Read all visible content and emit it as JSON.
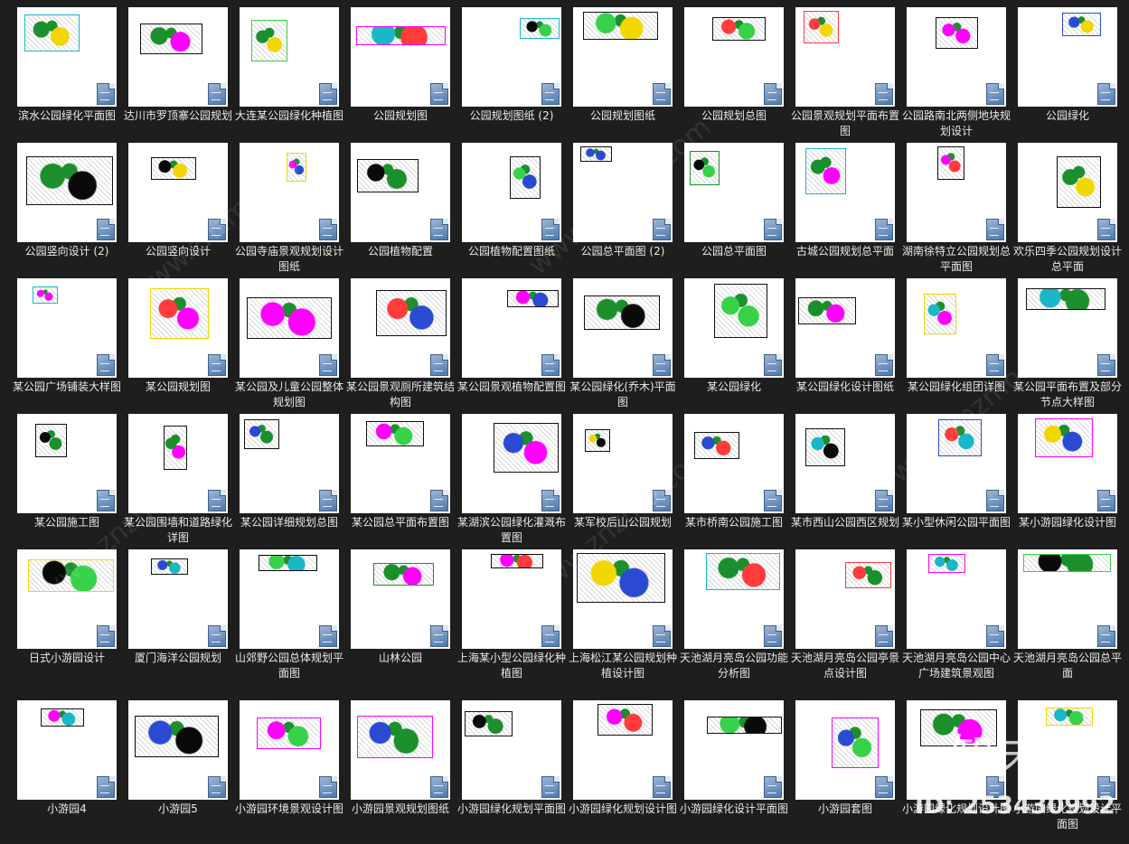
{
  "files": [
    {
      "name": "滨水公园绿化平面图",
      "icon": "cad-file-icon"
    },
    {
      "name": "达川市罗顶寨公园规划",
      "icon": "cad-file-icon"
    },
    {
      "name": "大连某公园绿化种植图",
      "icon": "cad-file-icon"
    },
    {
      "name": "公园规划图",
      "icon": "cad-file-icon"
    },
    {
      "name": "公园规划图纸 (2)",
      "icon": "cad-file-icon"
    },
    {
      "name": "公园规划图纸",
      "icon": "cad-file-icon"
    },
    {
      "name": "公园规划总图",
      "icon": "cad-file-icon"
    },
    {
      "name": "公园景观规划平面布置图",
      "icon": "cad-file-icon"
    },
    {
      "name": "公园路南北两侧地块规划设计",
      "icon": "cad-file-icon"
    },
    {
      "name": "公园绿化",
      "icon": "cad-file-icon"
    },
    {
      "name": "公园竖向设计 (2)",
      "icon": "cad-file-icon"
    },
    {
      "name": "公园竖向设计",
      "icon": "cad-file-icon"
    },
    {
      "name": "公园寺庙景观规划设计图纸",
      "icon": "cad-file-icon"
    },
    {
      "name": "公园植物配置",
      "icon": "cad-file-icon"
    },
    {
      "name": "公园植物配置图纸",
      "icon": "cad-file-icon"
    },
    {
      "name": "公园总平面图 (2)",
      "icon": "cad-file-icon"
    },
    {
      "name": "公园总平面图",
      "icon": "cad-file-icon"
    },
    {
      "name": "古城公园规划总平面",
      "icon": "cad-file-icon"
    },
    {
      "name": "湖南徐特立公园规划总平面图",
      "icon": "cad-file-icon"
    },
    {
      "name": "欢乐四季公园规划设计总平面",
      "icon": "cad-file-icon"
    },
    {
      "name": "某公园广场铺装大样图",
      "icon": "cad-file-icon"
    },
    {
      "name": "某公园规划图",
      "icon": "cad-file-icon"
    },
    {
      "name": "某公园及儿童公园整体规划图",
      "icon": "cad-file-icon"
    },
    {
      "name": "某公园景观厕所建筑结构图",
      "icon": "cad-file-icon"
    },
    {
      "name": "某公园景观植物配置图",
      "icon": "cad-file-icon"
    },
    {
      "name": "某公园绿化(乔木)平面图",
      "icon": "cad-file-icon"
    },
    {
      "name": "某公园绿化",
      "icon": "cad-file-icon"
    },
    {
      "name": "某公园绿化设计图纸",
      "icon": "cad-file-icon"
    },
    {
      "name": "某公园绿化组团详图",
      "icon": "cad-file-icon"
    },
    {
      "name": "某公园平面布置及部分节点大样图",
      "icon": "cad-file-icon"
    },
    {
      "name": "某公园施工图",
      "icon": "cad-file-icon"
    },
    {
      "name": "某公园围墙和道路绿化详图",
      "icon": "cad-file-icon"
    },
    {
      "name": "某公园详细规划总图",
      "icon": "cad-file-icon"
    },
    {
      "name": "某公园总平面布置图",
      "icon": "cad-file-icon"
    },
    {
      "name": "某湖滨公园绿化灌溉布置图",
      "icon": "cad-file-icon"
    },
    {
      "name": "某军校后山公园规划",
      "icon": "cad-file-icon"
    },
    {
      "name": "某市桥南公园施工图",
      "icon": "cad-file-icon"
    },
    {
      "name": "某市西山公园西区规划",
      "icon": "cad-file-icon"
    },
    {
      "name": "某小型休闲公园平面图",
      "icon": "cad-file-icon"
    },
    {
      "name": "某小游园绿化设计图",
      "icon": "cad-file-icon"
    },
    {
      "name": "日式小游园设计",
      "icon": "cad-file-icon"
    },
    {
      "name": "厦门海洋公园规划",
      "icon": "cad-file-icon"
    },
    {
      "name": "山郊野公园总体规划平面图",
      "icon": "cad-file-icon"
    },
    {
      "name": "山林公园",
      "icon": "cad-file-icon"
    },
    {
      "name": "上海某小型公园绿化种植图",
      "icon": "cad-file-icon"
    },
    {
      "name": "上海松江某公园规划种植设计图",
      "icon": "cad-file-icon"
    },
    {
      "name": "天池湖月亮岛公园功能分析图",
      "icon": "cad-file-icon"
    },
    {
      "name": "天池湖月亮岛公园亭景点设计图",
      "icon": "cad-file-icon"
    },
    {
      "name": "天池湖月亮岛公园中心广场建筑景观图",
      "icon": "cad-file-icon"
    },
    {
      "name": "天池湖月亮岛公园总平面",
      "icon": "cad-file-icon"
    },
    {
      "name": "小游园4",
      "icon": "cad-file-icon"
    },
    {
      "name": "小游园5",
      "icon": "cad-file-icon"
    },
    {
      "name": "小游园环境景观设计图",
      "icon": "cad-file-icon"
    },
    {
      "name": "小游园景观规划图纸",
      "icon": "cad-file-icon"
    },
    {
      "name": "小游园绿化规划平面图",
      "icon": "cad-file-icon"
    },
    {
      "name": "小游园绿化规划设计图",
      "icon": "cad-file-icon"
    },
    {
      "name": "小游园绿化设计平面图",
      "icon": "cad-file-icon"
    },
    {
      "name": "小游园套图",
      "icon": "cad-file-icon"
    },
    {
      "name": "小游园绿化规划设计图",
      "icon": "cad-file-icon"
    },
    {
      "name": "小游园绿化规划设计平面图",
      "icon": "cad-file-icon"
    }
  ],
  "watermark": {
    "brand": "知末",
    "asset_id": "ID: 253430992",
    "site": "www.znzmo.com"
  },
  "colors": {
    "background": "#1e1e1e",
    "thumbnail": "#ffffff",
    "label": "#eaeaea",
    "drawing_palette": [
      "#1b8f2b",
      "#37d24a",
      "#0a0a0a",
      "#ff00ff",
      "#19b7c8",
      "#ff3b3b",
      "#2a4bd1",
      "#f2d600"
    ]
  }
}
